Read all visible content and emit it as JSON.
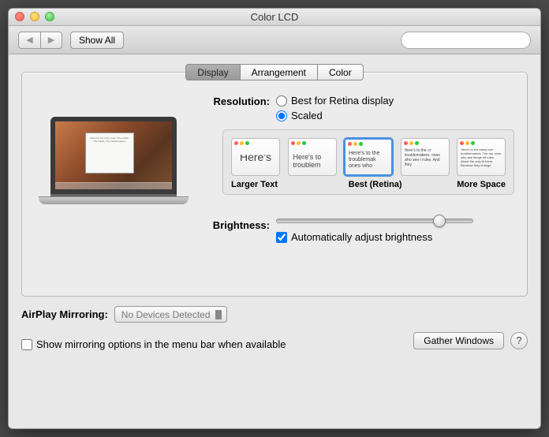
{
  "window": {
    "title": "Color LCD"
  },
  "toolbar": {
    "show_all": "Show All",
    "search_placeholder": ""
  },
  "tabs": {
    "display": "Display",
    "arrangement": "Arrangement",
    "color": "Color"
  },
  "resolution": {
    "label": "Resolution:",
    "option_best": "Best for Retina display",
    "option_scaled": "Scaled",
    "selected": "scaled"
  },
  "scale": {
    "thumbs": [
      {
        "text": "Here's"
      },
      {
        "text": "Here's to troublem"
      },
      {
        "text": "Here's to the troublemak ones who"
      },
      {
        "text": "Here's to the cr troublemakers. ones who see t rules. And they"
      },
      {
        "text": "Here's to the crazy one troublemakers. The rou ones who see things dif rules. About the only th them. Because they change"
      }
    ],
    "label_larger": "Larger Text",
    "label_best": "Best (Retina)",
    "label_more": "More Space"
  },
  "brightness": {
    "label": "Brightness:",
    "auto_label": "Automatically adjust brightness",
    "auto_checked": true,
    "value": 80
  },
  "airplay": {
    "label": "AirPlay Mirroring:",
    "selected": "No Devices Detected"
  },
  "mirroring": {
    "label": "Show mirroring options in the menu bar when available",
    "checked": false
  },
  "gather": "Gather Windows",
  "help": "?"
}
